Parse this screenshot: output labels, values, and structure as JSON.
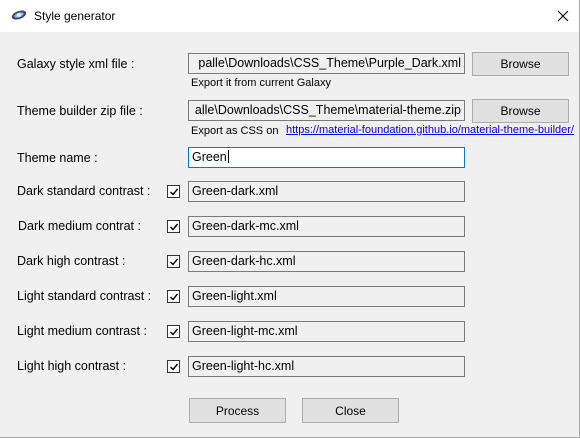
{
  "window": {
    "title": "Style generator",
    "icon": "app-icon",
    "close": "close-icon"
  },
  "galaxy": {
    "label": "Galaxy style xml file :",
    "value": "palle\\Downloads\\CSS_Theme\\Purple_Dark.xml",
    "browse": "Browse",
    "hint": "Export it from current Galaxy"
  },
  "theme_builder": {
    "label": "Theme builder zip file :",
    "value": "alle\\Downloads\\CSS_Theme\\material-theme.zip",
    "browse": "Browse",
    "hint": "Export as CSS on",
    "link": "https://material-foundation.github.io/material-theme-builder/"
  },
  "theme_name": {
    "label": "Theme name :",
    "value": "Green"
  },
  "contrasts": [
    {
      "label": "Dark standard contrast :",
      "checked": true,
      "value": "Green-dark.xml"
    },
    {
      "label": "Dark medium contrat :",
      "checked": true,
      "value": "Green-dark-mc.xml"
    },
    {
      "label": "Dark high contrast :",
      "checked": true,
      "value": "Green-dark-hc.xml"
    },
    {
      "label": "Light standard contrast :",
      "checked": true,
      "value": "Green-light.xml"
    },
    {
      "label": "Light medium contrast :",
      "checked": true,
      "value": "Green-light-mc.xml"
    },
    {
      "label": "Light high contrast :",
      "checked": true,
      "value": "Green-light-hc.xml"
    }
  ],
  "buttons": {
    "process": "Process",
    "close": "Close"
  }
}
